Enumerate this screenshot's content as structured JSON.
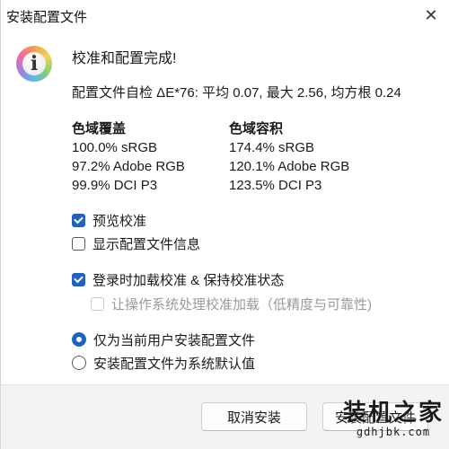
{
  "window": {
    "title": "安装配置文件",
    "close_glyph": "✕"
  },
  "icon": {
    "name": "info-icon",
    "glyph": "i"
  },
  "heading": "校准和配置完成!",
  "summary": "配置文件自检 ΔE*76: 平均 0.07, 最大 2.56, 均方根 0.24",
  "coverage": {
    "title": "色域覆盖",
    "lines": [
      "100.0% sRGB",
      "97.2% Adobe RGB",
      "99.9% DCI P3"
    ]
  },
  "volume": {
    "title": "色域容积",
    "lines": [
      "174.4% sRGB",
      "120.1% Adobe RGB",
      "123.5% DCI P3"
    ]
  },
  "options": {
    "preview": {
      "label": "预览校准",
      "checked": true
    },
    "show_info": {
      "label": "显示配置文件信息",
      "checked": false
    },
    "load_on_login": {
      "label": "登录时加载校准 & 保持校准状态",
      "checked": true
    },
    "os_handling": {
      "label": "让操作系统处理校准加载（低精度与可靠性)",
      "checked": false,
      "disabled": true
    }
  },
  "install_scope": {
    "current_user": {
      "label": "仅为当前用户安装配置文件",
      "selected": true
    },
    "system_default": {
      "label": "安装配置文件为系统默认值",
      "selected": false
    }
  },
  "buttons": {
    "cancel": "取消安装",
    "install": "安装配置文件"
  },
  "watermark": {
    "main": "装机之家",
    "sub": "gdhjbk.com"
  },
  "colors": {
    "accent": "#1e63c2",
    "footer_bg": "#f3f3f3"
  }
}
